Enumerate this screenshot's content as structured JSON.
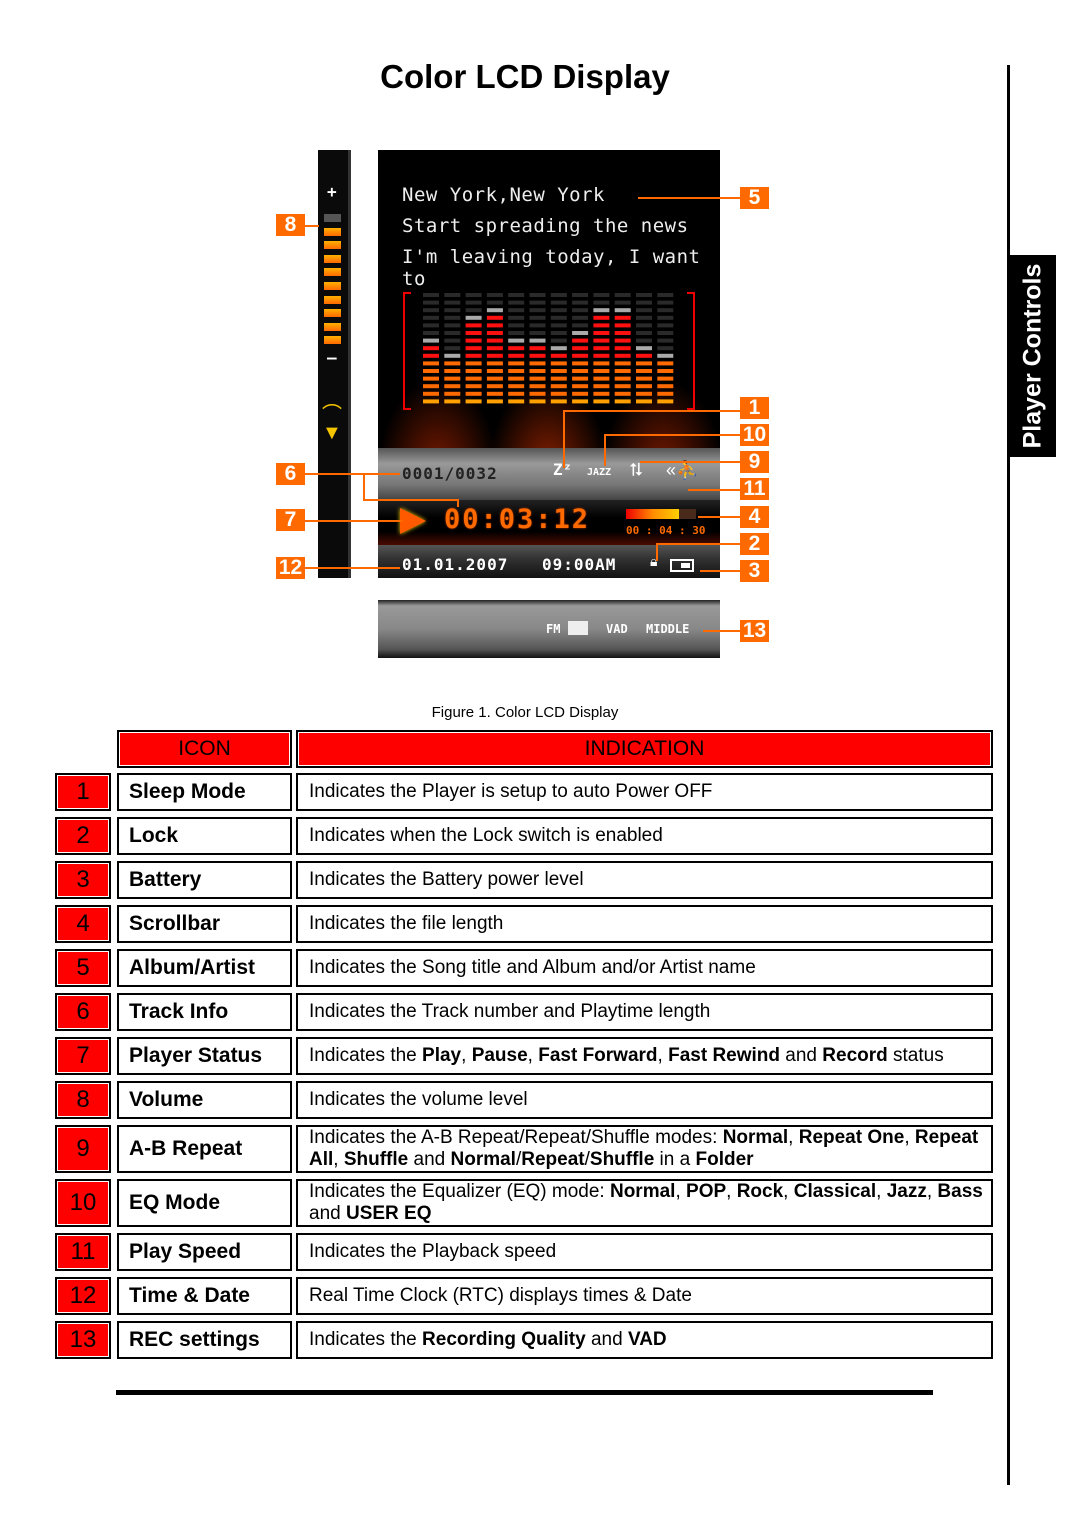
{
  "title": "Color LCD Display",
  "side_tab": "Player Controls",
  "figure_caption": "Figure 1. Color LCD Display",
  "lcd": {
    "volume_plus": "+",
    "volume_minus": "–",
    "volume_level": 9,
    "volume_max": 10,
    "lyrics": [
      "New York,New York",
      "Start spreading the news",
      "I'm leaving today, I want to"
    ],
    "eq_levels": [
      8,
      6,
      11,
      12,
      8,
      8,
      7,
      9,
      12,
      12,
      7,
      6
    ],
    "track": "0001/0032",
    "sleep_icon": "Zᶻ",
    "eq_mode": "JAZZ",
    "repeat_icon": "repeat-icon",
    "speed_icon": "play-speed-icon",
    "play_icon": "play-icon",
    "elapsed": "00:03:12",
    "progress_percent": 75,
    "total_time": "00 : 04 : 30",
    "date": "01.01.2007",
    "time": "09:00AM",
    "lock_icon": "lock-icon",
    "battery_icon": "battery-icon",
    "rec_source": "FM",
    "rec_vad": "VAD",
    "rec_quality": "MIDDLE",
    "colors": {
      "callout": "#ff6a00",
      "header": "#ff0000"
    }
  },
  "callouts": [
    "1",
    "2",
    "3",
    "4",
    "5",
    "6",
    "7",
    "8",
    "9",
    "10",
    "11",
    "12",
    "13"
  ],
  "table": {
    "headers": {
      "icon": "ICON",
      "indication": "INDICATION"
    },
    "rows": [
      {
        "num": "1",
        "icon": "Sleep Mode",
        "desc": [
          {
            "t": "Indicates the Player is setup to auto Power OFF"
          }
        ]
      },
      {
        "num": "2",
        "icon": "Lock",
        "desc": [
          {
            "t": "Indicates when the Lock switch is enabled"
          }
        ]
      },
      {
        "num": "3",
        "icon": "Battery",
        "desc": [
          {
            "t": "Indicates the Battery power level"
          }
        ]
      },
      {
        "num": "4",
        "icon": "Scrollbar",
        "desc": [
          {
            "t": "Indicates the file length"
          }
        ]
      },
      {
        "num": "5",
        "icon": "Album/Artist",
        "desc": [
          {
            "t": "Indicates the Song title and Album and/or Artist name"
          }
        ]
      },
      {
        "num": "6",
        "icon": "Track Info",
        "desc": [
          {
            "t": "Indicates the Track number and Playtime length"
          }
        ]
      },
      {
        "num": "7",
        "icon": "Player Status",
        "desc": [
          {
            "t": "Indicates the "
          },
          {
            "t": "Play",
            "b": true
          },
          {
            "t": ", "
          },
          {
            "t": "Pause",
            "b": true
          },
          {
            "t": ", "
          },
          {
            "t": "Fast Forward",
            "b": true
          },
          {
            "t": ", "
          },
          {
            "t": "Fast Rewind",
            "b": true
          },
          {
            "t": " and "
          },
          {
            "t": "Record",
            "b": true
          },
          {
            "t": " status"
          }
        ]
      },
      {
        "num": "8",
        "icon": "Volume",
        "desc": [
          {
            "t": "Indicates the volume level"
          }
        ]
      },
      {
        "num": "9",
        "icon": "A-B Repeat",
        "desc": [
          {
            "t": "Indicates the A-B Repeat/Repeat/Shuffle modes: "
          },
          {
            "t": "Normal",
            "b": true
          },
          {
            "t": ", "
          },
          {
            "t": "Repeat One",
            "b": true
          },
          {
            "t": ", "
          },
          {
            "t": "Repeat All",
            "b": true
          },
          {
            "t": ", "
          },
          {
            "t": "Shuffle",
            "b": true
          },
          {
            "t": " and "
          },
          {
            "t": "Normal",
            "b": true
          },
          {
            "t": "/"
          },
          {
            "t": "Repeat",
            "b": true
          },
          {
            "t": "/"
          },
          {
            "t": "Shuffle",
            "b": true
          },
          {
            "t": " in a "
          },
          {
            "t": "Folder",
            "b": true
          }
        ]
      },
      {
        "num": "10",
        "icon": "EQ Mode",
        "desc": [
          {
            "t": "Indicates the Equalizer (EQ) mode: "
          },
          {
            "t": "Normal",
            "b": true
          },
          {
            "t": ", "
          },
          {
            "t": "POP",
            "b": true
          },
          {
            "t": ", "
          },
          {
            "t": "Rock",
            "b": true
          },
          {
            "t": ", "
          },
          {
            "t": "Classical",
            "b": true
          },
          {
            "t": ", "
          },
          {
            "t": "Jazz",
            "b": true
          },
          {
            "t": ", "
          },
          {
            "t": "Bass",
            "b": true
          },
          {
            "t": " and "
          },
          {
            "t": "USER EQ",
            "b": true
          }
        ]
      },
      {
        "num": "11",
        "icon": "Play Speed",
        "desc": [
          {
            "t": "Indicates the Playback speed"
          }
        ]
      },
      {
        "num": "12",
        "icon": "Time & Date",
        "desc": [
          {
            "t": "Real Time Clock (RTC) displays times & Date"
          }
        ]
      },
      {
        "num": "13",
        "icon": "REC settings",
        "desc": [
          {
            "t": "Indicates the "
          },
          {
            "t": "Recording Quality",
            "b": true
          },
          {
            "t": " and "
          },
          {
            "t": "VAD",
            "b": true
          }
        ]
      }
    ]
  }
}
